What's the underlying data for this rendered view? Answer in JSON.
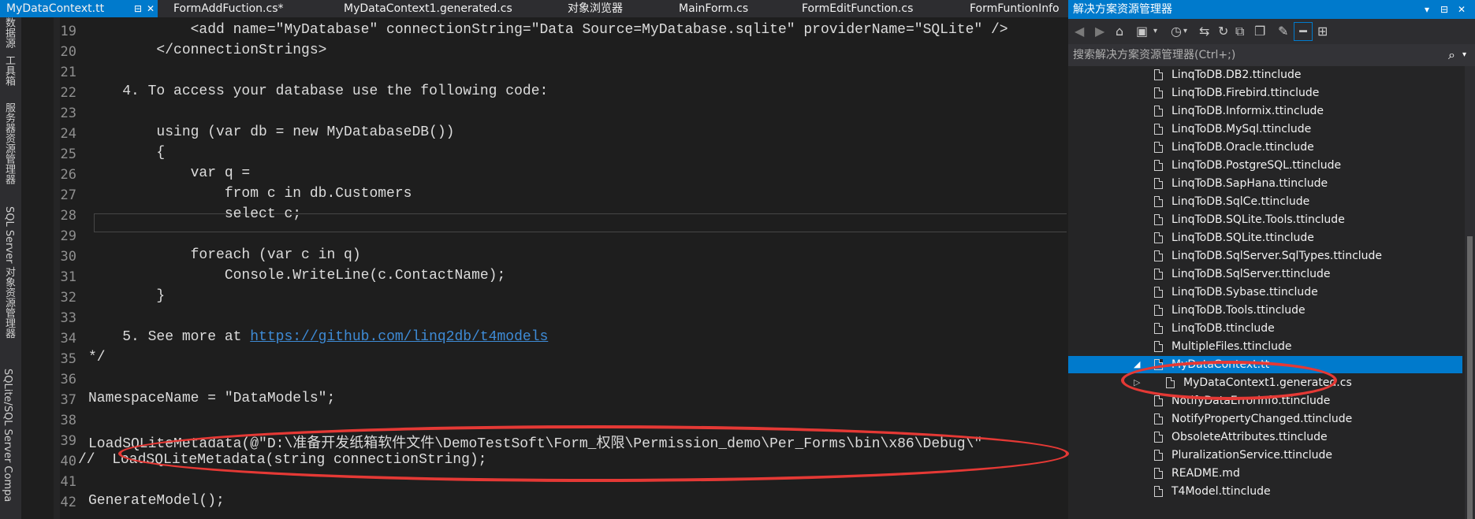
{
  "tabs": {
    "active": "MyDataContext.tt",
    "pin": "⊟",
    "close": "✕",
    "others": [
      "FormAddFuction.cs*",
      "MyDataContext1.generated.cs",
      "对象浏览器",
      "MainForm.cs",
      "FormEditFunction.cs",
      "FormFuntionInfo"
    ]
  },
  "left_strip": [
    "数据源",
    "工具箱",
    "服务器资源管理器",
    "SQL Server 对象资源管理器",
    "SQLite/SQL Server Compa"
  ],
  "editor": {
    "lines": [
      {
        "num": "19",
        "text": "            <add name=\"MyDatabase\" connectionString=\"Data Source=MyDatabase.sqlite\" providerName=\"SQLite\" />"
      },
      {
        "num": "20",
        "text": "        </connectionStrings>"
      },
      {
        "num": "21",
        "text": ""
      },
      {
        "num": "22",
        "text": "    4. To access your database use the following code:"
      },
      {
        "num": "23",
        "text": ""
      },
      {
        "num": "24",
        "text": "        using (var db = new MyDatabaseDB())"
      },
      {
        "num": "25",
        "text": "        {"
      },
      {
        "num": "26",
        "text": "            var q ="
      },
      {
        "num": "27",
        "text": "                from c in db.Customers"
      },
      {
        "num": "28",
        "text": "                select c;"
      },
      {
        "num": "29",
        "text": ""
      },
      {
        "num": "30",
        "text": "            foreach (var c in q)"
      },
      {
        "num": "31",
        "text": "                Console.WriteLine(c.ContactName);"
      },
      {
        "num": "32",
        "text": "        }"
      },
      {
        "num": "33",
        "text": ""
      },
      {
        "num": "34",
        "text": "    5. See more at "
      },
      {
        "num": "35",
        "text": "*/"
      },
      {
        "num": "36",
        "text": ""
      },
      {
        "num": "37",
        "text": "NamespaceName = \"DataModels\";"
      },
      {
        "num": "38",
        "text": ""
      },
      {
        "num": "39",
        "text": "LoadSQLiteMetadata(@\"D:\\准备开发纸箱软件文件\\DemoTestSoft\\Form_权限\\Permission_demo\\Per_Forms\\bin\\x86\\Debug\\\""
      },
      {
        "num": "40",
        "text": "//  LoadSQLiteMetadata(string connectionString);"
      },
      {
        "num": "41",
        "text": ""
      },
      {
        "num": "42",
        "text": "GenerateModel();"
      }
    ],
    "link_text": "https://github.com/linq2db/t4models"
  },
  "solution_explorer": {
    "title": "解决方案资源管理器",
    "title_controls": [
      "▾",
      "⊟",
      "✕"
    ],
    "search_placeholder": "搜索解决方案资源管理器(Ctrl+;)",
    "search_icon": "⌕",
    "items": [
      "LinqToDB.DB2.ttinclude",
      "LinqToDB.Firebird.ttinclude",
      "LinqToDB.Informix.ttinclude",
      "LinqToDB.MySql.ttinclude",
      "LinqToDB.Oracle.ttinclude",
      "LinqToDB.PostgreSQL.ttinclude",
      "LinqToDB.SapHana.ttinclude",
      "LinqToDB.SqlCe.ttinclude",
      "LinqToDB.SQLite.Tools.ttinclude",
      "LinqToDB.SQLite.ttinclude",
      "LinqToDB.SqlServer.SqlTypes.ttinclude",
      "LinqToDB.SqlServer.ttinclude",
      "LinqToDB.Sybase.ttinclude",
      "LinqToDB.Tools.ttinclude",
      "LinqToDB.ttinclude",
      "MultipleFiles.ttinclude",
      "MyDataContext.tt",
      "MyDataContext1.generated.cs",
      "NotifyDataErrorInfo.ttinclude",
      "NotifyPropertyChanged.ttinclude",
      "ObsoleteAttributes.ttinclude",
      "PluralizationService.ttinclude",
      "README.md",
      "T4Model.ttinclude"
    ],
    "selected_item": "MyDataContext.tt",
    "expand_arrow": "◢",
    "collapsed_arrow": "▷"
  },
  "colors": {
    "accent": "#007acc",
    "annotation": "#e53935"
  }
}
